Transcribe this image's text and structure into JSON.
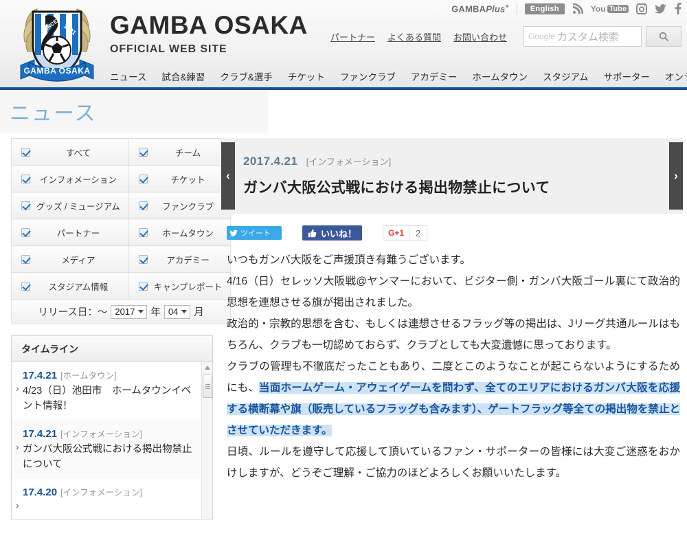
{
  "header": {
    "brand_title": "GAMBA OSAKA",
    "brand_sub": "OFFICIAL WEB SITE",
    "logo_alt": "gamba-osaka-crest",
    "gamba_plus": "GAMBA",
    "gamba_plus_italic": "Plus",
    "english_label": "English",
    "rss_icon": "rss-icon",
    "youtube_label_you": "You",
    "youtube_label_tube": "Tube",
    "instagram_icon": "instagram-icon",
    "twitter_icon": "twitter-icon",
    "facebook_icon": "facebook-icon",
    "util_links": [
      "パートナー",
      "よくある質問",
      "お問い合わせ"
    ],
    "search": {
      "google_label": "Google",
      "placeholder": "カスタム検索",
      "button_icon": "search-icon"
    },
    "nav": [
      "ニュース",
      "試合&練習",
      "クラブ&選手",
      "チケット",
      "ファンクラブ",
      "アカデミー",
      "ホームタウン",
      "スタジアム",
      "サポーター",
      "オンラインショップ"
    ]
  },
  "page": {
    "title": "ニュース"
  },
  "sidebar": {
    "filters": [
      {
        "left": "すべて",
        "right": "チーム"
      },
      {
        "left": "インフォメーション",
        "right": "チケット"
      },
      {
        "left": "グッズ / ミュージアム",
        "right": "ファンクラブ"
      },
      {
        "left": "パートナー",
        "right": "ホームタウン"
      },
      {
        "left": "メディア",
        "right": "アカデミー"
      },
      {
        "left": "スタジアム情報",
        "right": "キャンプレポート"
      }
    ],
    "release_date": {
      "label": "リリース日：〜",
      "year_value": "2017",
      "year_unit": "年",
      "month_value": "04",
      "month_unit": "月"
    },
    "timeline": {
      "heading": "タイムライン",
      "items": [
        {
          "date": "17.4.21",
          "category": "[ホームタウン]",
          "title": "4/23（日）池田市　ホームタウンイベント情報！"
        },
        {
          "date": "17.4.21",
          "category": "[インフォメーション]",
          "title": "ガンバ大阪公式戦における掲出物禁止について"
        },
        {
          "date": "17.4.20",
          "category": "[インフォメーション]",
          "title": ""
        }
      ]
    }
  },
  "article": {
    "prev_arrow": "‹",
    "next_arrow": "›",
    "date": "2017.4.21",
    "category": "[インフォメーション]",
    "title": "ガンバ大阪公式戦における掲出物禁止について",
    "share": {
      "tweet_label": "ツイート",
      "tweet_icon": "twitter-icon",
      "like_label": "いいね！",
      "like_icon": "thumbs-up-icon",
      "gplus_label": "G+1",
      "gplus_count": "2"
    },
    "paragraphs": [
      {
        "text": "いつもガンバ大阪をご声援頂き有難うございます。",
        "highlight": null
      },
      {
        "text": "4/16（日）セレッソ大阪戦@ヤンマーにおいて、ビジター側・ガンバ大阪ゴール裏にて政治的思想を連想させる旗が掲出されました。",
        "highlight": null
      },
      {
        "text": "政治的・宗教的思想を含む、もしくは連想させるフラッグ等の掲出は、Jリーグ共通ルールはもちろん、クラブも一切認めておらず、クラブとしても大変遺憾に思っております。",
        "highlight": null
      },
      {
        "prefix": "クラブの管理も不徹底だったこともあり、二度とこのようなことが起こらないようにするためにも、",
        "highlight": "当面ホームゲーム・アウェイゲームを問わず、全てのエリアにおけるガンバ大阪を応援する横断幕や旗（販売しているフラッグも含みます）、ゲートフラッグ等全ての掲出物を禁止とさせていただきます。",
        "suffix": ""
      },
      {
        "text": "日頃、ルールを遵守して応援して頂いているファン・サポーターの皆様には大変ご迷惑をおかけしますが、どうぞご理解・ご協力のほどよろしくお願いいたします。",
        "highlight": null
      }
    ]
  },
  "colors": {
    "nav_underline": "#14529b",
    "page_title": "#7fb0d4",
    "timeline_date": "#15518e",
    "highlight_bg": "#cde3f5",
    "highlight_text": "#19559c",
    "tweet_blue": "#3aa9e8",
    "facebook_blue": "#3b5998",
    "gplus_red": "#d5453c"
  }
}
